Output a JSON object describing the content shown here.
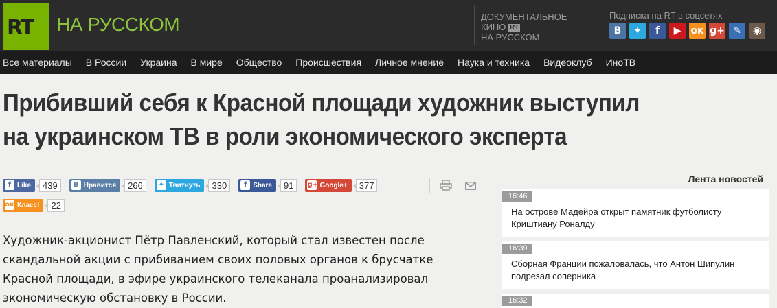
{
  "header": {
    "logo": "RT",
    "brand": "НА РУССКОМ",
    "doc_line1": "ДОКУМЕНТАЛЬНОЕ",
    "doc_line2_prefix": "КИНО",
    "doc_line2_logo": "RT",
    "doc_line3": "НА РУССКОМ",
    "subscribe": "Подписка на RT в соцсетях",
    "social": [
      {
        "name": "vk-icon",
        "glyph": "В",
        "color": "#4c75a3"
      },
      {
        "name": "twitter-icon",
        "glyph": "✦",
        "color": "#2ca7e0"
      },
      {
        "name": "facebook-icon",
        "glyph": "f",
        "color": "#3b5998"
      },
      {
        "name": "youtube-icon",
        "glyph": "▶",
        "color": "#cc181e"
      },
      {
        "name": "odnoklassniki-icon",
        "glyph": "ок",
        "color": "#f6901e"
      },
      {
        "name": "googleplus-icon",
        "glyph": "g+",
        "color": "#d34836"
      },
      {
        "name": "livejournal-icon",
        "glyph": "✎",
        "color": "#3b6fb5"
      },
      {
        "name": "instagram-icon",
        "glyph": "◉",
        "color": "#6b5a4b"
      }
    ]
  },
  "nav": [
    "Все материалы",
    "В России",
    "Украина",
    "В мире",
    "Общество",
    "Происшествия",
    "Личное мнение",
    "Наука и техника",
    "Видеоклуб",
    "ИноТВ"
  ],
  "article": {
    "headline": "Прибивший себя к Красной площади художник выступил на украинском ТВ в роли экономического эксперта",
    "lead": "Художник-акционист Пётр Павленский, который стал известен после скандальной акции с прибиванием своих половых органов к брусчатке Красной площади, в эфире украинского телеканала проанализировал экономическую обстановку в России."
  },
  "share": [
    {
      "label": "Like",
      "icon": "f",
      "count": "439",
      "color": "#4e69a2"
    },
    {
      "label": "Нравится",
      "icon": "В",
      "count": "266",
      "color": "#5b7fa6"
    },
    {
      "label": "Твитнуть",
      "icon": "✦",
      "count": "330",
      "color": "#2ca7e0"
    },
    {
      "label": "Share",
      "icon": "f",
      "count": "91",
      "color": "#3b5998"
    },
    {
      "label": "Google+",
      "icon": "g+",
      "count": "377",
      "color": "#d34836"
    },
    {
      "label": "Класс!",
      "icon": "ок",
      "count": "22",
      "color": "#f6901e"
    }
  ],
  "feed": {
    "title": "Лента новостей",
    "items": [
      {
        "time": "16:46",
        "text": "На острове Мадейра открыт памятник футболисту Криштиану Роналду"
      },
      {
        "time": "16:39",
        "text": "Сборная Франции пожаловалась, что Антон Шипулин подрезал соперника"
      },
      {
        "time": "16:32",
        "text": ""
      }
    ]
  }
}
